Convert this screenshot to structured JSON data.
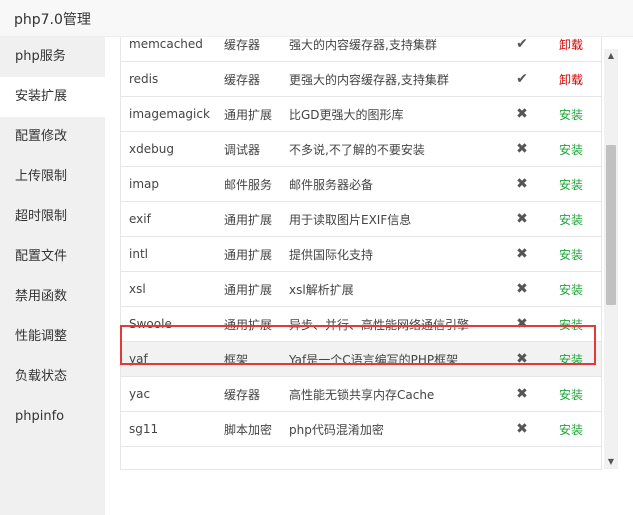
{
  "window": {
    "title": "php7.0管理"
  },
  "sidebar": {
    "items": [
      {
        "label": "php服务"
      },
      {
        "label": "安装扩展"
      },
      {
        "label": "配置修改"
      },
      {
        "label": "上传限制"
      },
      {
        "label": "超时限制"
      },
      {
        "label": "配置文件"
      },
      {
        "label": "禁用函数"
      },
      {
        "label": "性能调整"
      },
      {
        "label": "负载状态"
      },
      {
        "label": "phpinfo"
      }
    ],
    "active_index": 1
  },
  "extensions": {
    "rows": [
      {
        "name": "memcached",
        "type": "缓存器",
        "desc": "强大的内容缓存器,支持集群",
        "status_icon": "check-icon",
        "status": "✔",
        "action": "卸载"
      },
      {
        "name": "redis",
        "type": "缓存器",
        "desc": "更强大的内容缓存器,支持集群",
        "status_icon": "check-icon",
        "status": "✔",
        "action": "卸载"
      },
      {
        "name": "imagemagick",
        "type": "通用扩展",
        "desc": "比GD更强大的图形库",
        "status_icon": "cross-icon",
        "status": "✖",
        "action": "安装"
      },
      {
        "name": "xdebug",
        "type": "调试器",
        "desc": "不多说,不了解的不要安装",
        "status_icon": "cross-icon",
        "status": "✖",
        "action": "安装"
      },
      {
        "name": "imap",
        "type": "邮件服务",
        "desc": "邮件服务器必备",
        "status_icon": "cross-icon",
        "status": "✖",
        "action": "安装"
      },
      {
        "name": "exif",
        "type": "通用扩展",
        "desc": "用于读取图片EXIF信息",
        "status_icon": "cross-icon",
        "status": "✖",
        "action": "安装"
      },
      {
        "name": "intl",
        "type": "通用扩展",
        "desc": "提供国际化支持",
        "status_icon": "cross-icon",
        "status": "✖",
        "action": "安装"
      },
      {
        "name": "xsl",
        "type": "通用扩展",
        "desc": "xsl解析扩展",
        "status_icon": "cross-icon",
        "status": "✖",
        "action": "安装"
      },
      {
        "name": "Swoole",
        "type": "通用扩展",
        "desc": "异步、并行、高性能网络通信引擎",
        "status_icon": "cross-icon",
        "status": "✖",
        "action": "安装"
      },
      {
        "name": "yaf",
        "type": "框架",
        "desc": "Yaf是一个C语言编写的PHP框架",
        "status_icon": "cross-icon",
        "status": "✖",
        "action": "安装"
      },
      {
        "name": "yac",
        "type": "缓存器",
        "desc": "高性能无锁共享内存Cache",
        "status_icon": "cross-icon",
        "status": "✖",
        "action": "安装"
      },
      {
        "name": "sg11",
        "type": "脚本加密",
        "desc": "php代码混淆加密",
        "status_icon": "cross-icon",
        "status": "✖",
        "action": "安装"
      }
    ]
  },
  "colors": {
    "uninstall": "#d10000",
    "install": "#20a53a",
    "highlight_border": "#e23a3a",
    "sidebar_bg": "#f0f0f0"
  },
  "scrollbar": {
    "up_arrow": "▲",
    "down_arrow": "▼"
  }
}
